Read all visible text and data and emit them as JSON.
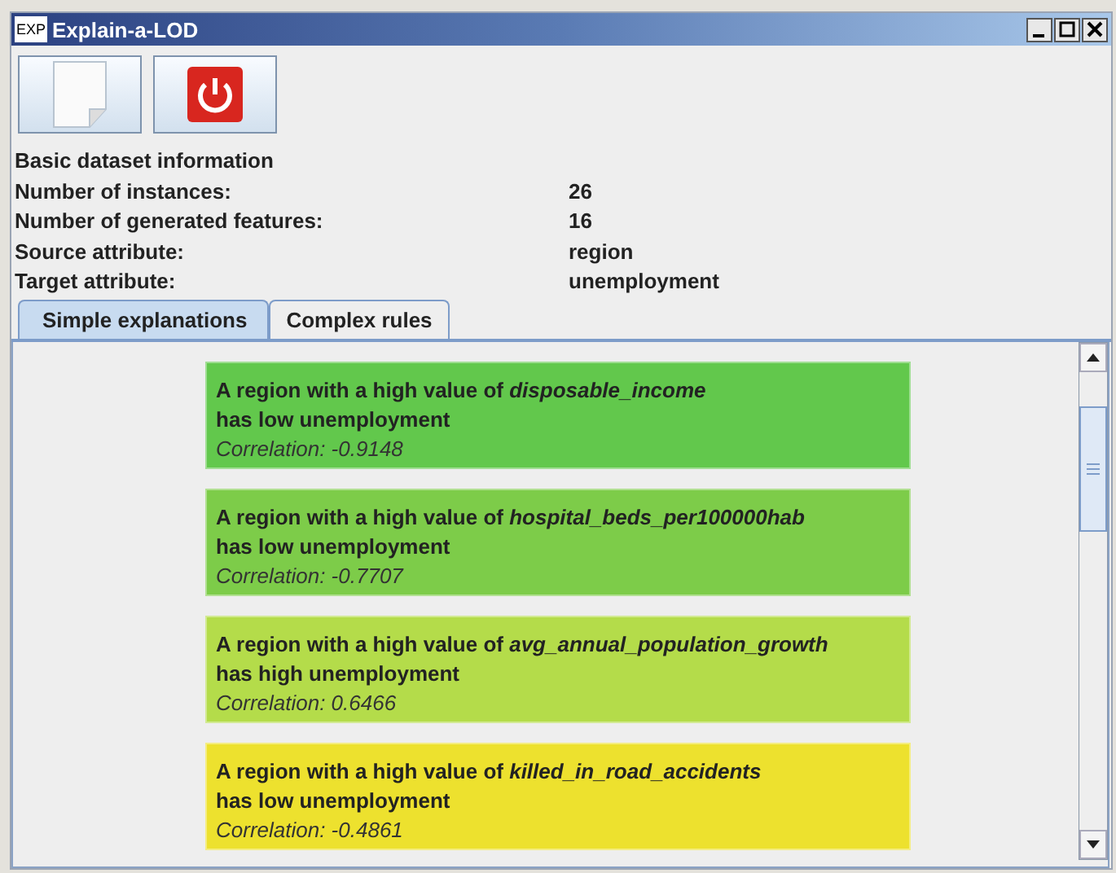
{
  "window": {
    "icon_text": "EXP",
    "title": "Explain-a-LOD"
  },
  "info": {
    "heading": "Basic dataset information",
    "rows": [
      {
        "label": "Number of instances:",
        "value": "26"
      },
      {
        "label": "Number of generated features:",
        "value": "16"
      },
      {
        "label": "Source attribute:",
        "value": "region"
      },
      {
        "label": "Target attribute:",
        "value": "unemployment"
      }
    ]
  },
  "tabs": [
    {
      "label": "Simple explanations",
      "selected": true
    },
    {
      "label": "Complex rules",
      "selected": false
    }
  ],
  "explanations": [
    {
      "text": "A region with a high value of *disposable_income*",
      "effect": "has low unemployment",
      "correlation": "Correlation: -0.9148",
      "color": "#62c84c"
    },
    {
      "text": "A region with a high value of *hospital_beds_per100000hab*",
      "effect": "has low unemployment",
      "correlation": "Correlation: -0.7707",
      "color": "#7dcc49"
    },
    {
      "text": "A region with a high value of *avg_annual_population_growth*",
      "effect": "has high unemployment",
      "correlation": "Correlation: 0.6466",
      "color": "#b4dc4a"
    },
    {
      "text": "A region with a high value of *killed_in_road_accidents*",
      "effect": "has low unemployment",
      "correlation": "Correlation: -0.4861",
      "color": "#ede12e"
    }
  ]
}
